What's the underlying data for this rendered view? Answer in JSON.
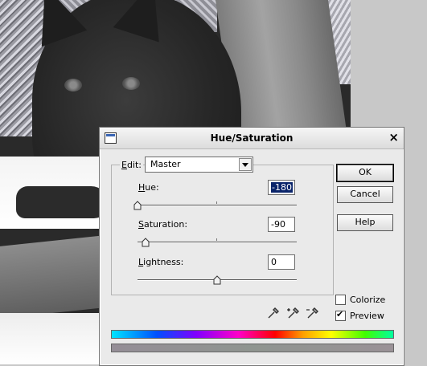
{
  "dialog": {
    "title": "Hue/Saturation",
    "close_glyph": "×",
    "edit": {
      "label_underlined": "E",
      "label_rest": "dit:",
      "value": "Master"
    },
    "hue": {
      "label_underlined": "H",
      "label_rest": "ue:",
      "value": "-180"
    },
    "saturation": {
      "label_underlined": "S",
      "label_rest": "aturation:",
      "value": "-90"
    },
    "lightness": {
      "label_underlined": "L",
      "label_rest": "ightness:",
      "value": "0"
    },
    "buttons": {
      "ok": "OK",
      "cancel": "Cancel",
      "help": "Help"
    },
    "colorize": {
      "label": "Colorize",
      "checked": false
    },
    "preview": {
      "label": "Preview",
      "checked": true
    },
    "slider_levels": {
      "hue": -180,
      "saturation": -90,
      "lightness": 0
    },
    "bars": {
      "top": "color-spectrum-bar",
      "bottom": "adjusted-spectrum-bar"
    },
    "accent_selection": "#0a246a"
  }
}
